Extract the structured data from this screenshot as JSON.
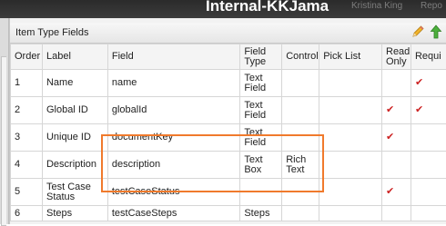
{
  "app": {
    "title": "Internal-KKJama",
    "user": "Kristina King",
    "reports": "Repo"
  },
  "panel": {
    "title": "Item Type Fields",
    "edit_icon": "pencil-icon",
    "up_icon": "arrow-up-icon"
  },
  "columns": {
    "order": "Order",
    "label": "Label",
    "field": "Field",
    "field_type": "Field Type",
    "control": "Control",
    "pick_list": "Pick List",
    "read_only": "Read Only",
    "required": "Requi"
  },
  "rows": [
    {
      "order": "1",
      "label": "Name",
      "field": "name",
      "field_type": "Text Field",
      "control": "",
      "pick_list": "",
      "read_only": "",
      "required": "✔"
    },
    {
      "order": "2",
      "label": "Global ID",
      "field": "globalId",
      "field_type": "Text Field",
      "control": "",
      "pick_list": "",
      "read_only": "✔",
      "required": "✔"
    },
    {
      "order": "3",
      "label": "Unique ID",
      "field": "documentKey",
      "field_type": "Text Field",
      "control": "",
      "pick_list": "",
      "read_only": "✔",
      "required": ""
    },
    {
      "order": "4",
      "label": "Description",
      "field": "description",
      "field_type": "Text Box",
      "control": "Rich Text",
      "pick_list": "",
      "read_only": "",
      "required": ""
    },
    {
      "order": "5",
      "label": "Test Case Status",
      "field": "testCaseStatus",
      "field_type": "",
      "control": "",
      "pick_list": "",
      "read_only": "✔",
      "required": ""
    },
    {
      "order": "6",
      "label": "Steps",
      "field": "testCaseSteps",
      "field_type": "Steps",
      "control": "",
      "pick_list": "",
      "read_only": "",
      "required": ""
    }
  ],
  "colors": {
    "highlight": "#f07a2c",
    "check": "#cc2222",
    "topbar": "#333333"
  }
}
